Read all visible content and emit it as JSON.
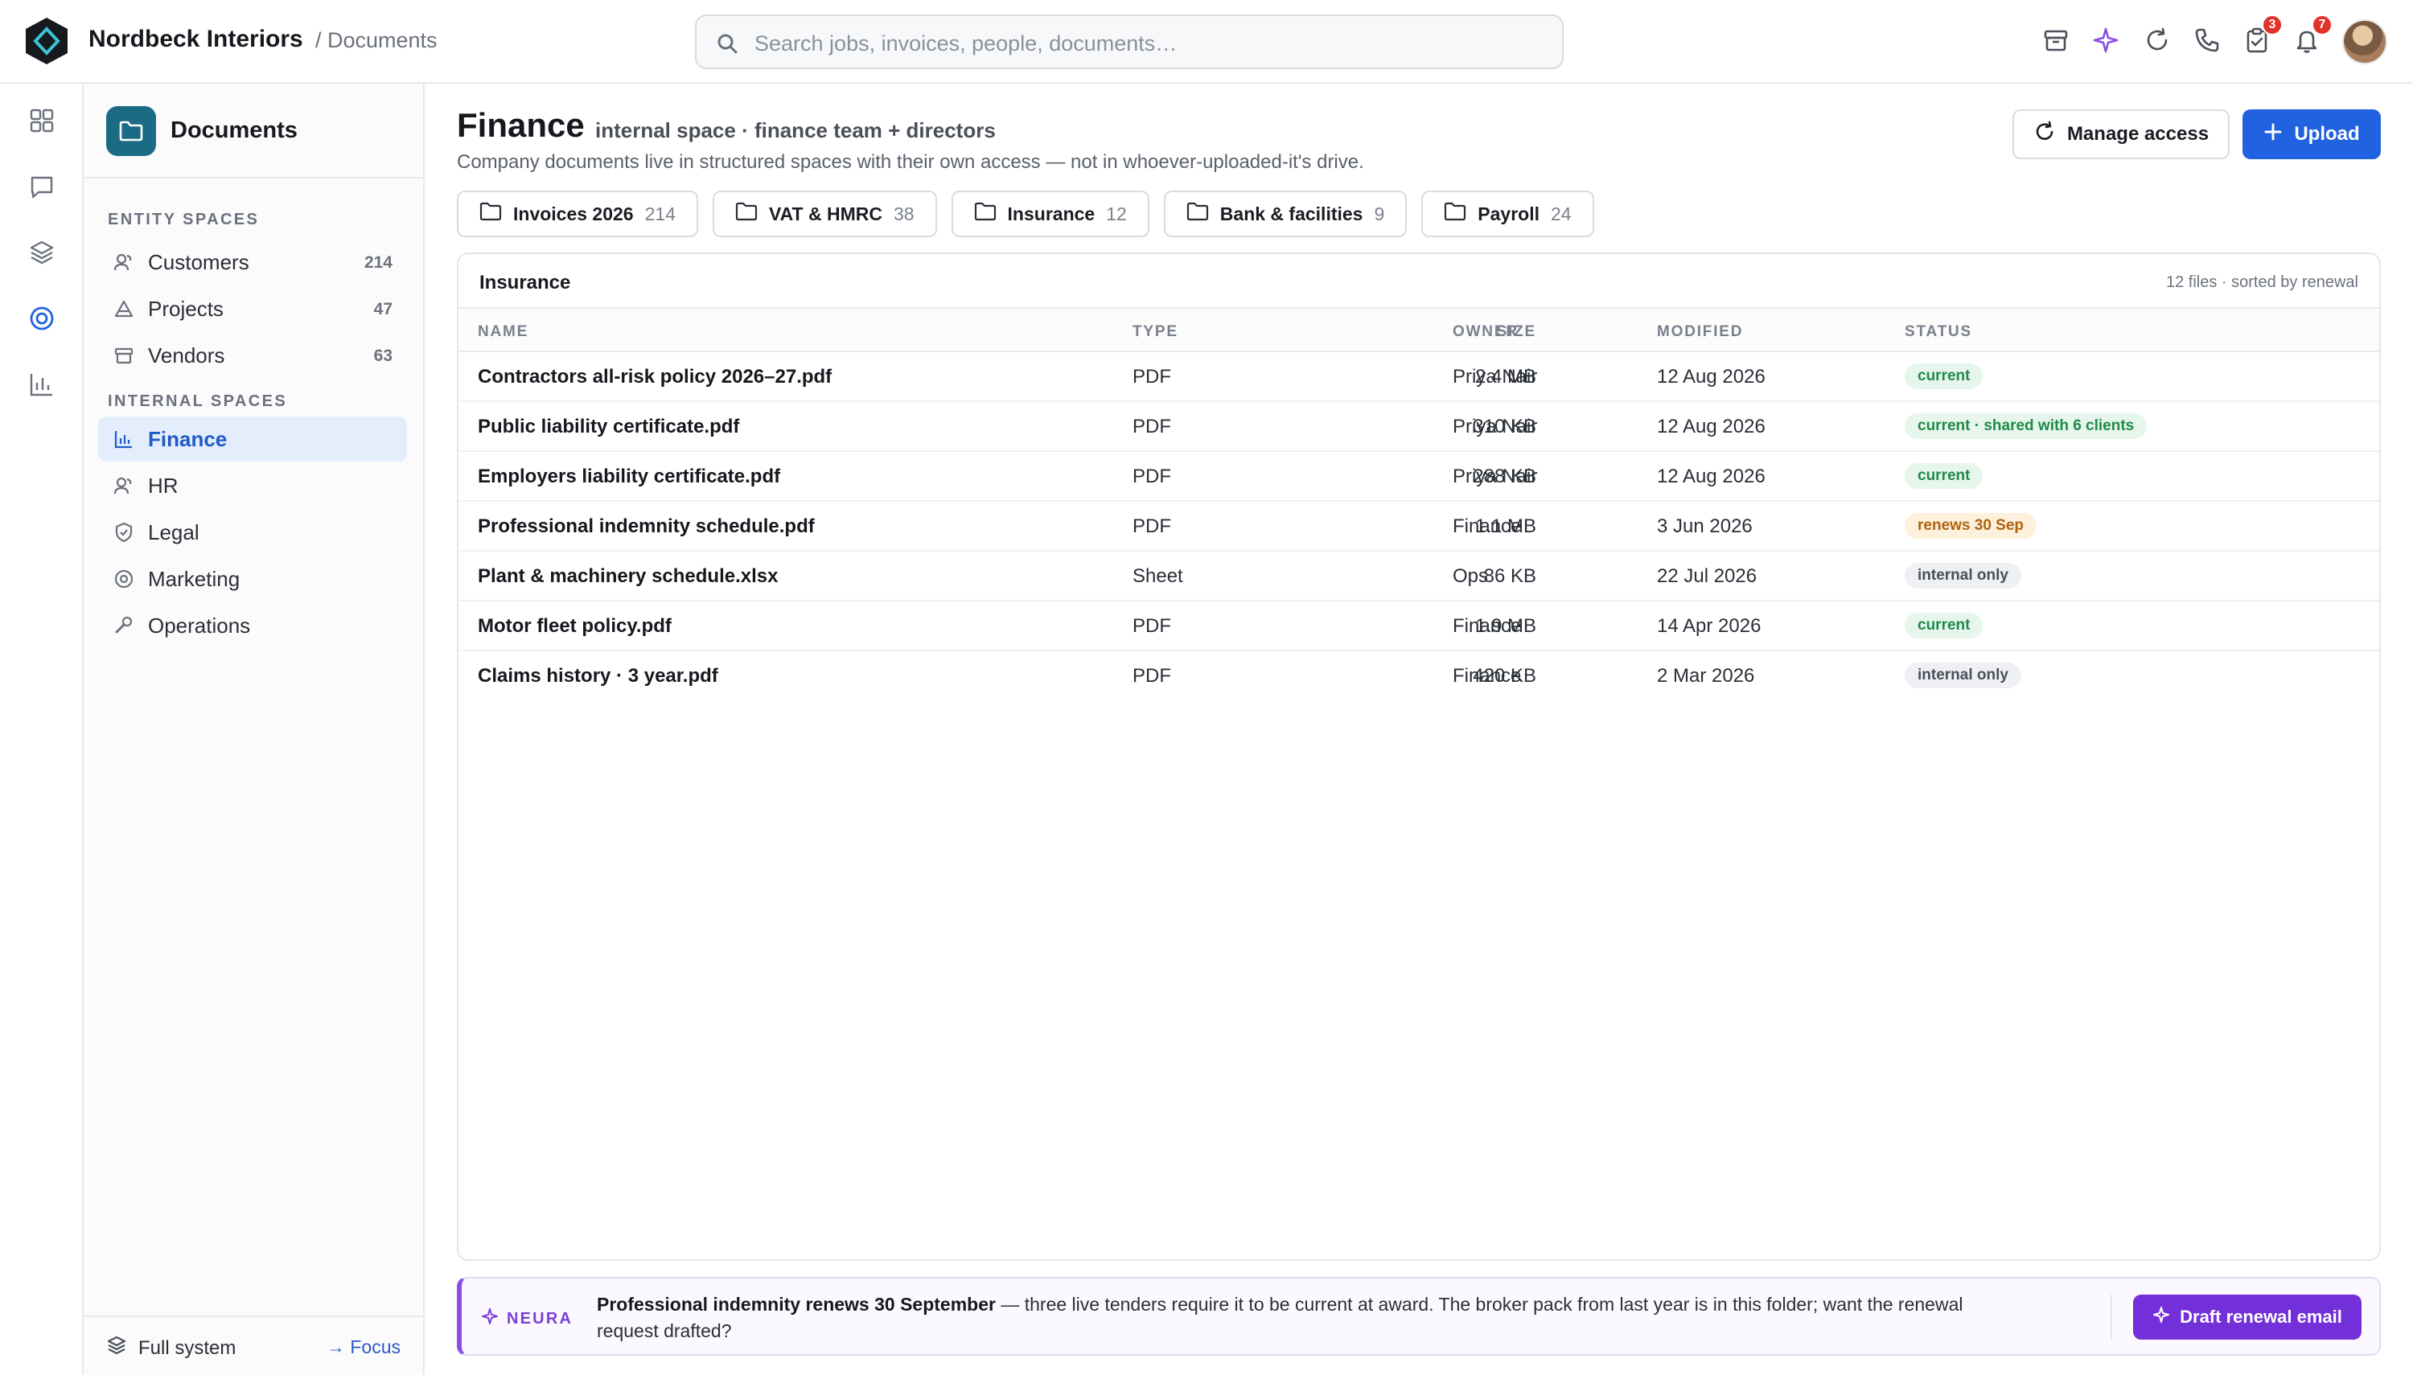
{
  "app": {
    "brand": "Nordbeck Interiors",
    "breadcrumb": "/ Documents"
  },
  "search": {
    "placeholder": "Search jobs, invoices, people, documents…",
    "value": ""
  },
  "topbar": {
    "icons": [
      "archive-icon",
      "sparkle-icon",
      "refresh-icon",
      "phone-icon",
      "tasks-icon",
      "bell-icon"
    ],
    "tasks_badge": "3",
    "notifications_badge": "7"
  },
  "rail": {
    "icons": [
      "grid-icon",
      "chat-icon",
      "layers-icon",
      "target-icon",
      "chart-icon"
    ],
    "active": "target-icon"
  },
  "sidebar": {
    "title": "Documents",
    "entity_label": "ENTITY SPACES",
    "entity_items": [
      {
        "label": "Customers",
        "count": "214",
        "icon": "customers-icon"
      },
      {
        "label": "Projects",
        "count": "47",
        "icon": "projects-icon"
      },
      {
        "label": "Vendors",
        "count": "63",
        "icon": "vendors-icon"
      }
    ],
    "internal_label": "INTERNAL SPACES",
    "internal_items": [
      {
        "label": "Finance",
        "icon": "finance-icon",
        "active": true
      },
      {
        "label": "HR",
        "icon": "hr-icon"
      },
      {
        "label": "Legal",
        "icon": "legal-icon"
      },
      {
        "label": "Marketing",
        "icon": "marketing-icon"
      },
      {
        "label": "Operations",
        "icon": "operations-icon"
      }
    ],
    "footer_left": "Full system",
    "footer_right": "→ Focus"
  },
  "page": {
    "title": "Finance",
    "subtitle": "internal space · finance team + directors",
    "description": "Company documents live in structured spaces with their own access — not in whoever-uploaded-it's drive.",
    "manage_label": "Manage access",
    "upload_label": "Upload"
  },
  "folders": [
    {
      "label": "Invoices 2026",
      "count": "214"
    },
    {
      "label": "VAT & HMRC",
      "count": "38"
    },
    {
      "label": "Insurance",
      "count": "12"
    },
    {
      "label": "Bank & facilities",
      "count": "9"
    },
    {
      "label": "Payroll",
      "count": "24"
    }
  ],
  "table": {
    "title": "Insurance",
    "meta": "12 files · sorted by renewal",
    "columns": {
      "name": "NAME",
      "type": "TYPE",
      "size": "SIZE",
      "owner": "OWNER",
      "modified": "MODIFIED",
      "status": "STATUS"
    },
    "rows": [
      {
        "name": "Contractors all-risk policy 2026–27.pdf",
        "type": "PDF",
        "size": "2.4 MB",
        "owner": "Priya Nair",
        "modified": "12 Aug 2026",
        "status": "current",
        "status_color": "green"
      },
      {
        "name": "Public liability certificate.pdf",
        "type": "PDF",
        "size": "310 KB",
        "owner": "Priya Nair",
        "modified": "12 Aug 2026",
        "status": "current · shared with 6 clients",
        "status_color": "green"
      },
      {
        "name": "Employers liability certificate.pdf",
        "type": "PDF",
        "size": "288 KB",
        "owner": "Priya Nair",
        "modified": "12 Aug 2026",
        "status": "current",
        "status_color": "green"
      },
      {
        "name": "Professional indemnity schedule.pdf",
        "type": "PDF",
        "size": "1.1 MB",
        "owner": "Finance",
        "modified": "3 Jun 2026",
        "status": "renews 30 Sep",
        "status_color": "amber"
      },
      {
        "name": "Plant & machinery schedule.xlsx",
        "type": "Sheet",
        "size": "86 KB",
        "owner": "Ops",
        "modified": "22 Jul 2026",
        "status": "internal only",
        "status_color": "grey"
      },
      {
        "name": "Motor fleet policy.pdf",
        "type": "PDF",
        "size": "1.9 MB",
        "owner": "Finance",
        "modified": "14 Apr 2026",
        "status": "current",
        "status_color": "green"
      },
      {
        "name": "Claims history · 3 year.pdf",
        "type": "PDF",
        "size": "420 KB",
        "owner": "Finance",
        "modified": "2 Mar 2026",
        "status": "internal only",
        "status_color": "grey"
      }
    ]
  },
  "neura": {
    "tag": "NEURA",
    "headline": "Professional indemnity renews 30 September",
    "body": " — three live tenders require it to be current at award. The broker pack from last year is in this folder; want the renewal request drafted?",
    "action_label": "Draft renewal email"
  },
  "colors": {
    "accent": "#2162e0",
    "neura": "#7330d8",
    "status_green": "#1f8a48",
    "status_amber": "#b0620e"
  }
}
